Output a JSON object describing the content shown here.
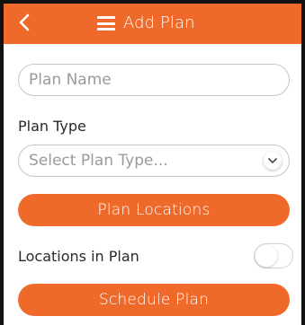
{
  "header": {
    "title": "Add Plan",
    "back_icon": "chevron-left-icon",
    "menu_icon": "menu-icon"
  },
  "form": {
    "plan_name": {
      "value": "",
      "placeholder": "Plan Name"
    },
    "plan_type": {
      "label": "Plan Type",
      "selected": "Select Plan Type..."
    },
    "plan_locations_button": "Plan Locations",
    "locations_in_plan": {
      "label": "Locations in Plan",
      "enabled": false
    },
    "schedule_button": "Schedule Plan"
  },
  "colors": {
    "accent": "#ef6a2a",
    "text": "#2a2a2a",
    "placeholder": "#9a9a9a",
    "border": "#c6c6c6"
  }
}
